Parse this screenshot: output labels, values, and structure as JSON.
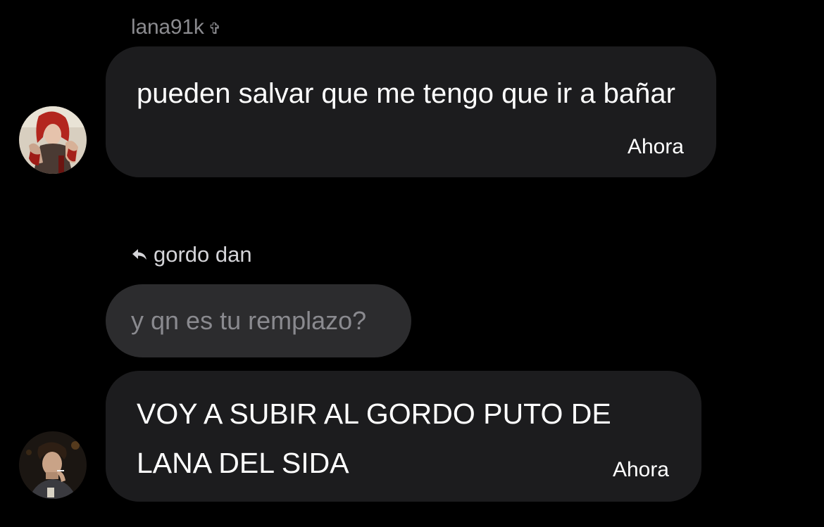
{
  "thread": {
    "sender_name": "lana91k",
    "sender_badge_glyph": "✞",
    "messages": [
      {
        "text": "pueden salvar que me tengo que ir a bañar",
        "time": "Ahora",
        "avatar_icon": "avatar-red-hair-bloody-hands"
      },
      {
        "reply_to_name": "gordo dan",
        "reply_icon": "reply-arrow-icon",
        "quoted_text": "y qn es tu remplazo?",
        "text": "VOY A SUBIR AL GORDO PUTO DE LANA DEL SIDA",
        "time": "Ahora",
        "avatar_icon": "avatar-dark-haired-man-smoking"
      }
    ]
  },
  "colors": {
    "background": "#000000",
    "bubble": "#1c1c1e",
    "quoted_bubble": "#2c2c2e",
    "secondary_text": "#8b8b8f"
  }
}
